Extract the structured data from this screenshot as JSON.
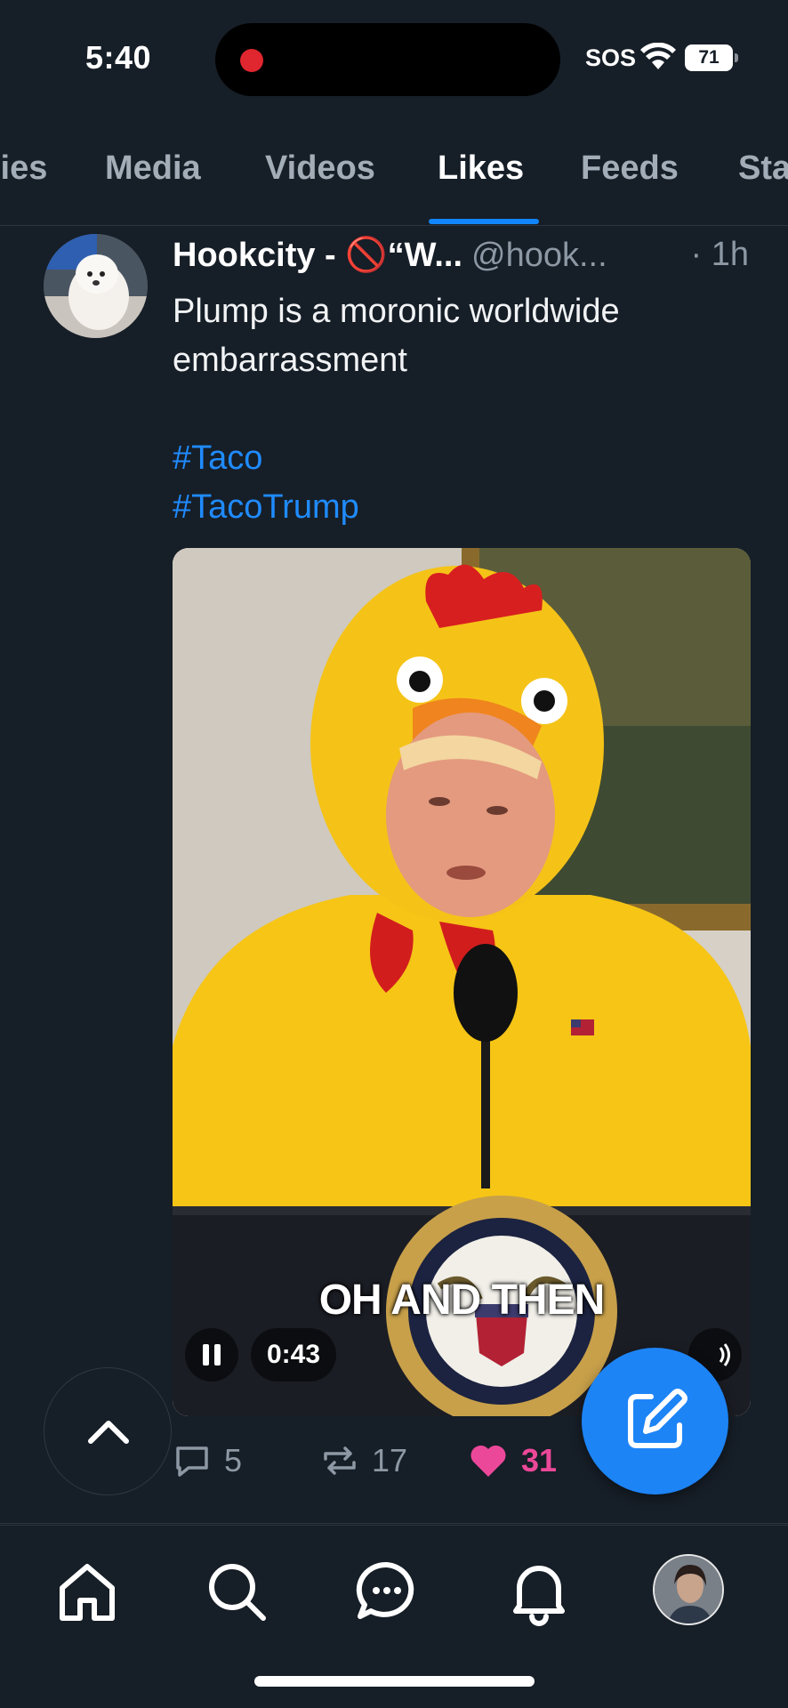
{
  "status_bar": {
    "time": "5:40",
    "carrier": "SOS",
    "battery": "71"
  },
  "tabs": [
    {
      "label": "lies",
      "active": false
    },
    {
      "label": "Media",
      "active": false
    },
    {
      "label": "Videos",
      "active": false
    },
    {
      "label": "Likes",
      "active": true
    },
    {
      "label": "Feeds",
      "active": false
    },
    {
      "label": "Sta",
      "active": false
    }
  ],
  "post": {
    "display_name": "Hookcity - 🚫“W...",
    "handle": "@hook...",
    "time": "· 1h",
    "text": "Plump is a moronic worldwide embarrassment",
    "hashtags": [
      "#Taco",
      "#TacoTrump"
    ],
    "video": {
      "caption": "OH AND THEN",
      "elapsed": "0:43",
      "playing": true
    },
    "actions": {
      "replies": "5",
      "reposts": "17",
      "likes": "31"
    }
  },
  "icons": {
    "reply": "speech-bubble-icon",
    "repost": "repost-arrows-icon",
    "like": "heart-icon",
    "compose": "compose-pencil-icon",
    "scroll_top": "chevron-up-icon"
  },
  "bottom_nav": [
    "home-icon",
    "search-icon",
    "chat-icon",
    "bell-icon",
    "profile-avatar"
  ],
  "colors": {
    "background": "#161e27",
    "accent": "#1185fe",
    "hashtag": "#208bfe",
    "like": "#ec4899",
    "muted": "#8d98a5"
  }
}
